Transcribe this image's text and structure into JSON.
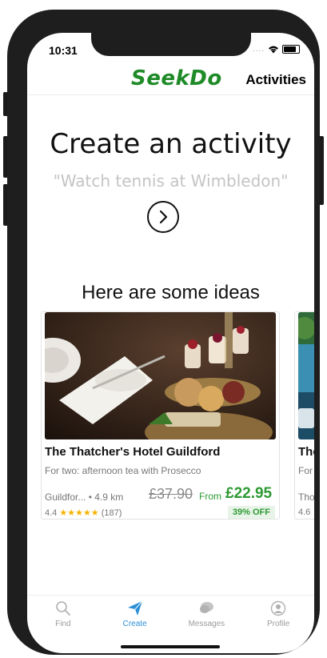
{
  "status_bar": {
    "time": "10:31",
    "signal_dots": "...."
  },
  "header": {
    "logo": "SeekDo",
    "activities_label": "Activities"
  },
  "create": {
    "title": "Create an activity",
    "input_placeholder": "\"Watch tennis at Wimbledon\""
  },
  "ideas": {
    "title": "Here are some ideas",
    "cards": [
      {
        "title": "The Thatcher's Hotel Guildford",
        "subtitle": "For two: afternoon tea with Prosecco",
        "location": "Guildfor... • 4.9 km",
        "old_price": "£37.90",
        "from_label": "From",
        "price": "£22.95",
        "rating": "4.4",
        "stars": "★★★★★",
        "reviews": "(187)",
        "badge": "39% OFF"
      },
      {
        "title": "The",
        "subtitle": "For",
        "location": "Tho",
        "rating": "4.6"
      }
    ]
  },
  "tabbar": {
    "items": [
      {
        "label": "Find",
        "icon": "search-icon"
      },
      {
        "label": "Create",
        "icon": "send-icon"
      },
      {
        "label": "Messages",
        "icon": "chat-icon"
      },
      {
        "label": "Profile",
        "icon": "profile-icon"
      }
    ],
    "active": "Create"
  },
  "colors": {
    "brand": "#1f8b28",
    "price": "#2e9a33",
    "tab_active": "#2a8fd6",
    "star": "#f4b400"
  }
}
